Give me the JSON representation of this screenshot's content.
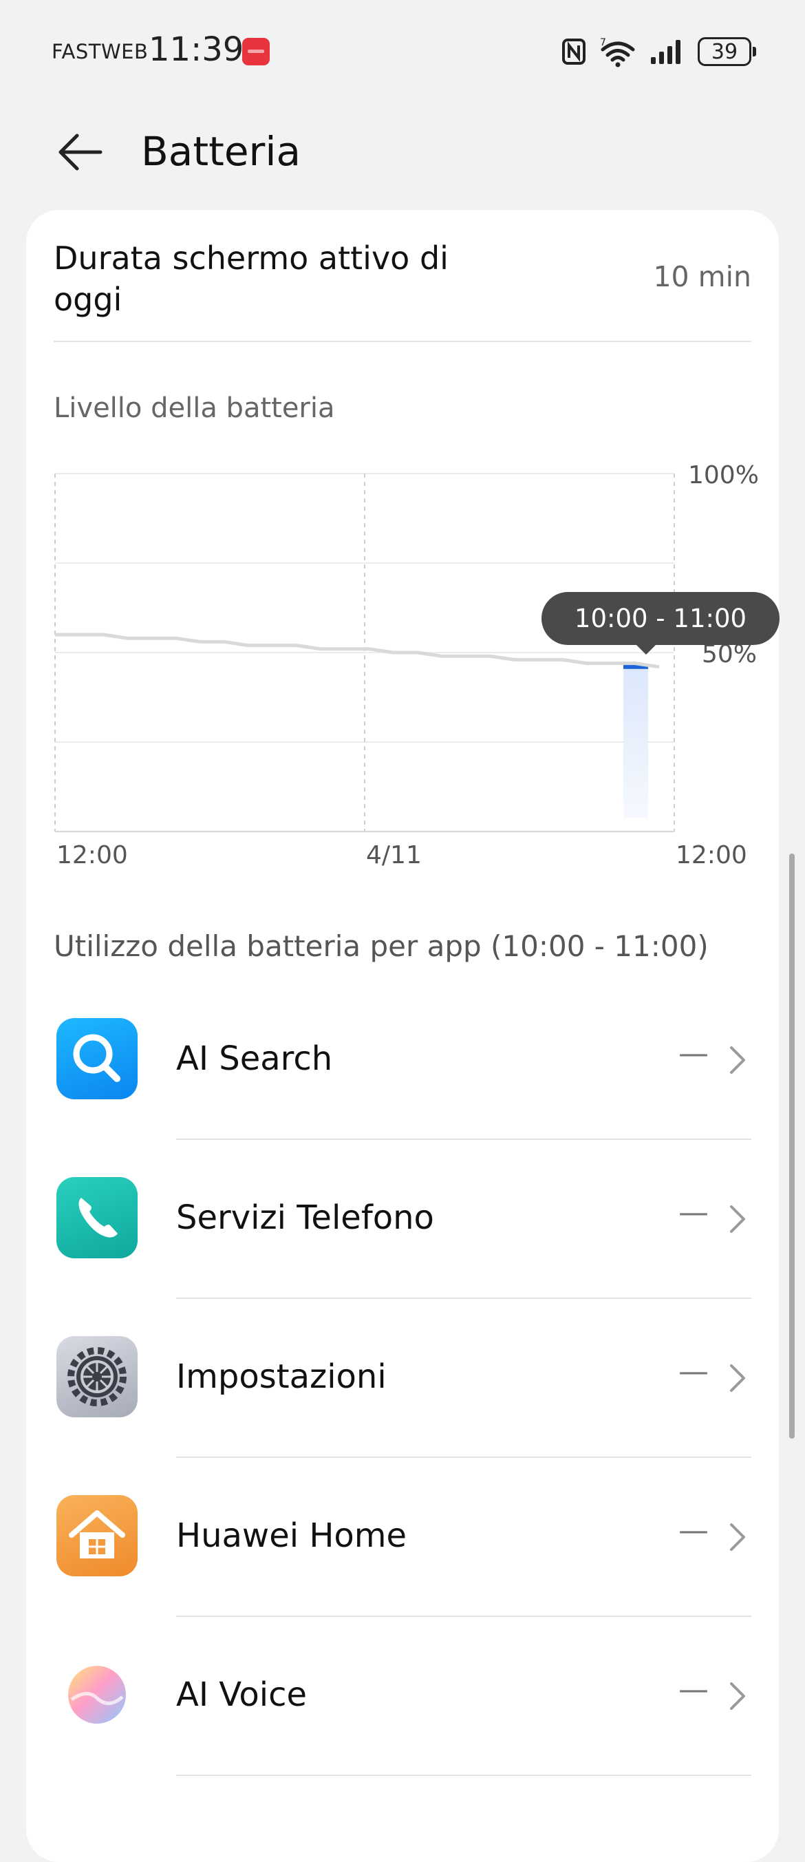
{
  "status_bar": {
    "carrier": "FASTWEB",
    "time": "11:39",
    "battery": "39"
  },
  "header": {
    "title": "Batteria"
  },
  "screen_time": {
    "label": "Durata schermo attivo di oggi",
    "value": "10 min"
  },
  "battery_chart": {
    "label": "Livello della batteria",
    "tooltip": "10:00 - 11:00",
    "chart_data": {
      "type": "line",
      "title": "Livello della batteria",
      "x_ticks": [
        "12:00",
        "4/11",
        "12:00"
      ],
      "y_ticks": [
        "100%",
        "50%"
      ],
      "ylim": [
        0,
        100
      ],
      "grid": true,
      "series": [
        {
          "values": [
            55,
            55,
            55,
            54,
            54,
            54,
            53,
            53,
            52,
            52,
            52,
            51,
            51,
            51,
            50,
            50,
            49,
            49,
            49,
            48,
            48,
            48,
            47,
            47,
            47,
            46
          ]
        }
      ],
      "selected_range": "10:00 - 11:00",
      "selected_value": 46
    }
  },
  "app_usage": {
    "label": "Utilizzo della batteria per app (10:00 - 11:00)",
    "apps": [
      {
        "name": "AI Search",
        "value": "—"
      },
      {
        "name": "Servizi Telefono",
        "value": "—"
      },
      {
        "name": "Impostazioni",
        "value": "—"
      },
      {
        "name": "Huawei Home",
        "value": "—"
      },
      {
        "name": "AI Voice",
        "value": "—"
      }
    ]
  },
  "colors": {
    "background": "#f1f2f4",
    "accent": "#1e64d8",
    "line": "#d9d9d9",
    "tooltip": "#4a4a4a"
  }
}
